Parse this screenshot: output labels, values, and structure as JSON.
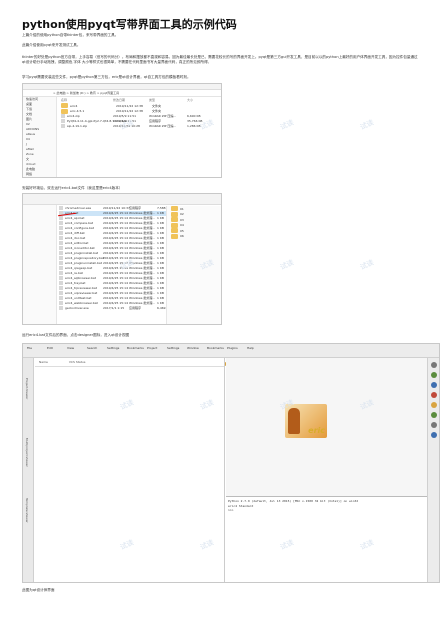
{
  "title": "python使用pyqt写带界面工具的示例代码",
  "paragraphs": {
    "p1": "上篇介绍的使用python自带tkinter包，来写带界面的工具。",
    "p2": "此篇介绍使用pyqt来开发测试工具。",
    "p3": "tkinter的好处是python官方自带，上手容易（但写的代码分）。布局和摆放都不直观和容易。因为最佳最长处是已，需要花较长的写的界面开发上。pyqt是第三方gui开发工具，是目前以以的python上最好的用户体界面开发工具，因为控件包量通过qt设计助分手动拖拽，调整颜色 字体 大小等样式也很简单，不需要在代码里面书写大量界面代码，真正的所见即所得。",
    "p4": "学习pyqt需要安装这些文件，pyqt是python第三方包，eric是qt设计界面，qt自工具打包的模板看时刻。",
    "p5": "安装好环境后，双击运行eric4.bat文件（我这里是eric4版本）",
    "p6": "运行eric4.bat文件后的界面，点击designer图标，进入qt设计视图",
    "p7": "此图为qt设计师界面"
  },
  "explorer1": {
    "address": "> 此电脑 > 新加坡 (D:) > 教育 > pyqt界面工具",
    "sidebar": [
      "快速访问",
      "桌面",
      "下载",
      "文档",
      "图片",
      "02",
      "ADDONS",
      "eReus",
      "04",
      "J",
      "eMail",
      "Zone",
      "文",
      "iCloud",
      "此电脑",
      "网络"
    ],
    "columns": [
      "名称",
      "修改日期",
      "类型",
      "大小"
    ],
    "files": [
      {
        "name": "eric4",
        "date": "2019/11/22 12:38",
        "type": "文件夹",
        "size": ""
      },
      {
        "name": "eric-4.5.1",
        "date": "2019/11/22 12:38",
        "type": "文件夹",
        "size": ""
      },
      {
        "name": "eric4.zip",
        "date": "2019/5/9 11:51",
        "type": "WinRAR ZIP 压缩...",
        "size": "6,690 KB"
      },
      {
        "name": "PyQt4-4.11.4-gpl-Py2.7-Qt4.8.7-x32.exe",
        "date": "2019/5/9 11:51",
        "type": "应用程序",
        "size": "35,766 KB"
      },
      {
        "name": "sip-4.19.1.zip",
        "date": "2019/10/28 10:28",
        "type": "WinRAR ZIP 压缩...",
        "size": "1,286 KB"
      }
    ]
  },
  "explorer2": {
    "files": [
      {
        "name": "chromedriver.exe",
        "date": "2019/11/22 10:37",
        "type": "应用程序",
        "size": "7,588 KB"
      },
      {
        "name": "eric4.bat",
        "date": "2019/4/25 15:14",
        "type": "Windows 批处理...",
        "size": "1 KB"
      },
      {
        "name": "eric4_api.bat",
        "date": "2019/4/25 15:14",
        "type": "Windows 批处理...",
        "size": "1 KB"
      },
      {
        "name": "eric4_compare.bat",
        "date": "2019/4/25 15:14",
        "type": "Windows 批处理...",
        "size": "1 KB"
      },
      {
        "name": "eric4_configure.bat",
        "date": "2019/4/25 15:14",
        "type": "Windows 批处理...",
        "size": "1 KB"
      },
      {
        "name": "eric4_diff.bat",
        "date": "2019/4/25 15:14",
        "type": "Windows 批处理...",
        "size": "1 KB"
      },
      {
        "name": "eric4_doc.bat",
        "date": "2019/4/25 15:14",
        "type": "Windows 批处理...",
        "size": "1 KB"
      },
      {
        "name": "eric4_editor.bat",
        "date": "2019/4/25 15:14",
        "type": "Windows 批处理...",
        "size": "1 KB"
      },
      {
        "name": "eric4_iconeditor.bat",
        "date": "2019/4/25 15:14",
        "type": "Windows 批处理...",
        "size": "1 KB"
      },
      {
        "name": "eric4_plugininstall.bat",
        "date": "2019/4/25 15:14",
        "type": "Windows 批处理...",
        "size": "1 KB"
      },
      {
        "name": "eric4_pluginrepository.bat",
        "date": "2019/4/25 15:14",
        "type": "Windows 批处理...",
        "size": "1 KB"
      },
      {
        "name": "eric4_pluginuninstall.bat",
        "date": "2019/4/25 15:14",
        "type": "Windows 批处理...",
        "size": "1 KB"
      },
      {
        "name": "eric4_qregexp.bat",
        "date": "2019/4/25 15:14",
        "type": "Windows 批处理...",
        "size": "1 KB"
      },
      {
        "name": "eric4_re.bat",
        "date": "2019/4/25 15:14",
        "type": "Windows 批处理...",
        "size": "1 KB"
      },
      {
        "name": "eric4_sqlbrowser.bat",
        "date": "2019/4/25 15:14",
        "type": "Windows 批处理...",
        "size": "1 KB"
      },
      {
        "name": "eric4_tray.bat",
        "date": "2019/4/25 15:14",
        "type": "Windows 批处理...",
        "size": "1 KB"
      },
      {
        "name": "eric4_trpreviewer.bat",
        "date": "2019/4/25 15:14",
        "type": "Windows 批处理...",
        "size": "1 KB"
      },
      {
        "name": "eric4_uipreviewer.bat",
        "date": "2019/4/25 15:14",
        "type": "Windows 批处理...",
        "size": "1 KB"
      },
      {
        "name": "eric4_unittest.bat",
        "date": "2019/4/25 15:14",
        "type": "Windows 批处理...",
        "size": "1 KB"
      },
      {
        "name": "eric4_webbrowser.bat",
        "date": "2019/4/25 15:14",
        "type": "Windows 批处理...",
        "size": "1 KB"
      },
      {
        "name": "geckodriver.exe",
        "date": "2017/1/1 1:15",
        "type": "应用程序",
        "size": "6,469 KB"
      }
    ],
    "right_folders": [
      "01",
      "02",
      "03",
      "04",
      "05",
      "06"
    ]
  },
  "eric": {
    "window_title": "eric4",
    "menu": [
      "File",
      "Edit",
      "View",
      "Search",
      "Settings",
      "Bookmarks",
      "Project",
      "Settings",
      "Window",
      "Bookmarks",
      "Plugins",
      "Help"
    ],
    "left_tabs": [
      "Project-Viewer",
      "Multiproject-Viewer",
      "Template-Viewer"
    ],
    "pane_header": [
      "Name",
      "VCS Status"
    ],
    "console_lines": [
      "Python 2.7.9 (default, Jul 13 2015) [MSC v.1500 32 bit (Intel)] on win32",
      "eric4 Standard",
      ">>>"
    ],
    "logo": "eric"
  },
  "watermark": "试读"
}
